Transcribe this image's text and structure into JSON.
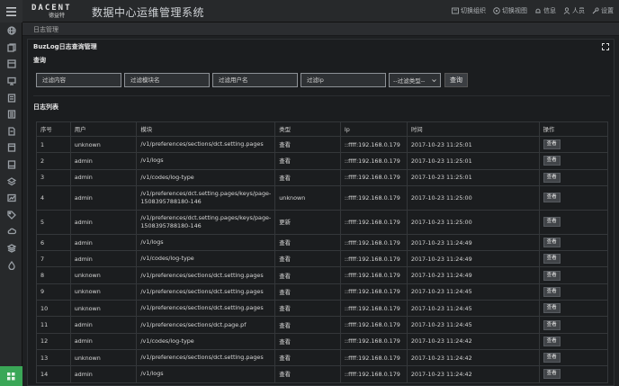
{
  "header": {
    "logo_text": "DACENT",
    "logo_sub": "德益特",
    "title": "数据中心运维管理系统",
    "actions": [
      {
        "icon": "switch-org-icon",
        "label": "切换组织"
      },
      {
        "icon": "switch-view-icon",
        "label": "切换视图"
      },
      {
        "icon": "info-icon",
        "label": "信息"
      },
      {
        "icon": "person-icon",
        "label": "人员"
      },
      {
        "icon": "wrench-icon",
        "label": "设置"
      }
    ]
  },
  "sidebar": {
    "items": [
      "globe-icon",
      "files-icon",
      "box-icon",
      "monitor-icon",
      "list-icon",
      "layers-icon",
      "document-icon",
      "server-icon",
      "server-alt-icon",
      "stack-icon",
      "chart-icon",
      "tag-icon",
      "cloud-icon",
      "stack-alt-icon",
      "drop-icon"
    ],
    "bottom_icon": "grid-icon"
  },
  "breadcrumb": "日志管理",
  "panel": {
    "title": "BuzLog日志查询管理",
    "query_section": "查询",
    "list_section": "日志列表"
  },
  "filters": {
    "content_placeholder": "过滤内容",
    "module_placeholder": "过滤模块名",
    "user_placeholder": "过滤用户名",
    "ip_placeholder": "过滤ip",
    "type_select": "--过滤类型--",
    "query_button": "查询"
  },
  "table": {
    "headers": [
      "序号",
      "用户",
      "模块",
      "类型",
      "Ip",
      "时间",
      "操作"
    ],
    "action_label": "查看",
    "rows": [
      {
        "no": "1",
        "user": "unknown",
        "module": "/v1/preferences/sections/dct.setting.pages",
        "type": "查看",
        "ip": "::ffff:192.168.0.179",
        "time": "2017-10-23 11:25:01"
      },
      {
        "no": "2",
        "user": "admin",
        "module": "/v1/logs",
        "type": "查看",
        "ip": "::ffff:192.168.0.179",
        "time": "2017-10-23 11:25:01"
      },
      {
        "no": "3",
        "user": "admin",
        "module": "/v1/codes/log-type",
        "type": "查看",
        "ip": "::ffff:192.168.0.179",
        "time": "2017-10-23 11:25:01"
      },
      {
        "no": "4",
        "user": "admin",
        "module": "/v1/preferences/dct.setting.pages/keys/page-1508395788180-146",
        "type": "unknown",
        "ip": "::ffff:192.168.0.179",
        "time": "2017-10-23 11:25:00"
      },
      {
        "no": "5",
        "user": "admin",
        "module": "/v1/preferences/dct.setting.pages/keys/page-1508395788180-146",
        "type": "更新",
        "ip": "::ffff:192.168.0.179",
        "time": "2017-10-23 11:25:00"
      },
      {
        "no": "6",
        "user": "admin",
        "module": "/v1/logs",
        "type": "查看",
        "ip": "::ffff:192.168.0.179",
        "time": "2017-10-23 11:24:49"
      },
      {
        "no": "7",
        "user": "admin",
        "module": "/v1/codes/log-type",
        "type": "查看",
        "ip": "::ffff:192.168.0.179",
        "time": "2017-10-23 11:24:49"
      },
      {
        "no": "8",
        "user": "unknown",
        "module": "/v1/preferences/sections/dct.setting.pages",
        "type": "查看",
        "ip": "::ffff:192.168.0.179",
        "time": "2017-10-23 11:24:49"
      },
      {
        "no": "9",
        "user": "unknown",
        "module": "/v1/preferences/sections/dct.setting.pages",
        "type": "查看",
        "ip": "::ffff:192.168.0.179",
        "time": "2017-10-23 11:24:45"
      },
      {
        "no": "10",
        "user": "unknown",
        "module": "/v1/preferences/sections/dct.setting.pages",
        "type": "查看",
        "ip": "::ffff:192.168.0.179",
        "time": "2017-10-23 11:24:45"
      },
      {
        "no": "11",
        "user": "admin",
        "module": "/v1/preferences/sections/dct.page.pf",
        "type": "查看",
        "ip": "::ffff:192.168.0.179",
        "time": "2017-10-23 11:24:45"
      },
      {
        "no": "12",
        "user": "admin",
        "module": "/v1/codes/log-type",
        "type": "查看",
        "ip": "::ffff:192.168.0.179",
        "time": "2017-10-23 11:24:42"
      },
      {
        "no": "13",
        "user": "unknown",
        "module": "/v1/preferences/sections/dct.setting.pages",
        "type": "查看",
        "ip": "::ffff:192.168.0.179",
        "time": "2017-10-23 11:24:42"
      },
      {
        "no": "14",
        "user": "admin",
        "module": "/v1/logs",
        "type": "查看",
        "ip": "::ffff:192.168.0.179",
        "time": "2017-10-23 11:24:42"
      }
    ]
  },
  "colors": {
    "background": "#1e2022",
    "panel": "#1b1d1f",
    "accent_green": "#3aa757"
  }
}
